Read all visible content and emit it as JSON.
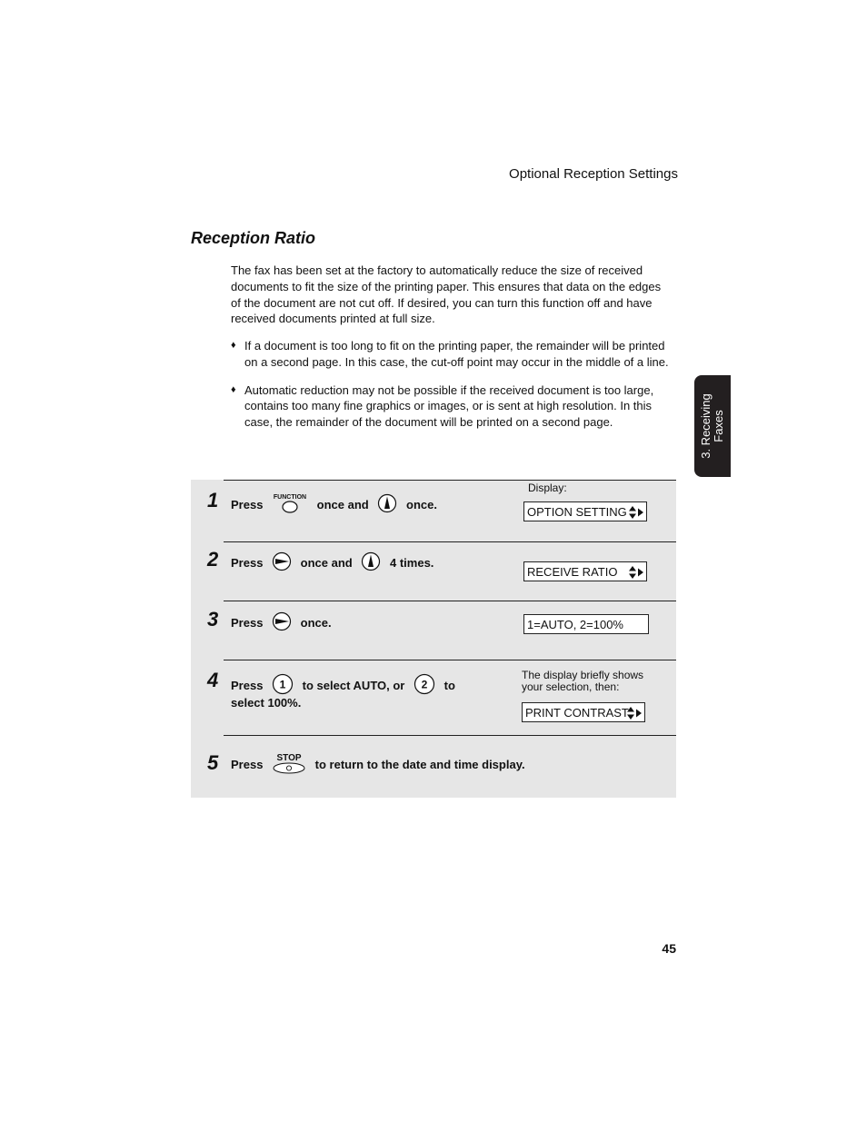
{
  "header": {
    "running_title": "Optional Reception Settings"
  },
  "section": {
    "title": "Reception Ratio",
    "intro": "The fax has been set at the factory to automatically reduce the size of received documents to fit the size of the printing paper. This ensures that data on the edges of the document are not cut off. If desired, you can turn this function off and have received documents printed at full size.",
    "bullet_glyph": "♦",
    "bullets": [
      "If a document is too long to fit on the printing paper, the remainder will be printed on a second page. In this case, the cut-off point may occur in the middle of a line.",
      "Automatic reduction may not be possible if the received document is too large, contains too many fine graphics or images, or is sent at high resolution. In this case, the remainder of the document will be printed on a second page."
    ]
  },
  "side_tab": {
    "line1": "3. Receiving",
    "line2": "Faxes"
  },
  "steps": {
    "display_label": "Display:",
    "items": [
      {
        "num": "1",
        "press": "Press",
        "key1_label": "FUNCTION",
        "key1_icon": "function-key-icon",
        "mid": "once and",
        "key2_icon": "up-arrow-key-icon",
        "end": "once.",
        "display": "OPTION SETTING"
      },
      {
        "num": "2",
        "press": "Press",
        "key1_icon": "right-arrow-key-icon",
        "mid": "once and",
        "key2_icon": "up-arrow-key-icon",
        "end": "4 times.",
        "display": "RECEIVE RATIO"
      },
      {
        "num": "3",
        "press": "Press",
        "key1_icon": "right-arrow-key-icon",
        "end": "once.",
        "display": "1=AUTO, 2=100%"
      },
      {
        "num": "4",
        "press": "Press",
        "key1_label": "1",
        "mid": "to select AUTO, or",
        "key2_label": "2",
        "end": "to",
        "line2": "select 100%.",
        "note": "The display briefly shows your selection, then:",
        "display": "PRINT CONTRAST"
      },
      {
        "num": "5",
        "press": "Press",
        "key1_label": "STOP",
        "key1_icon": "stop-key-icon",
        "end": "to return to the date and time display."
      }
    ]
  },
  "footer": {
    "page_number": "45"
  }
}
